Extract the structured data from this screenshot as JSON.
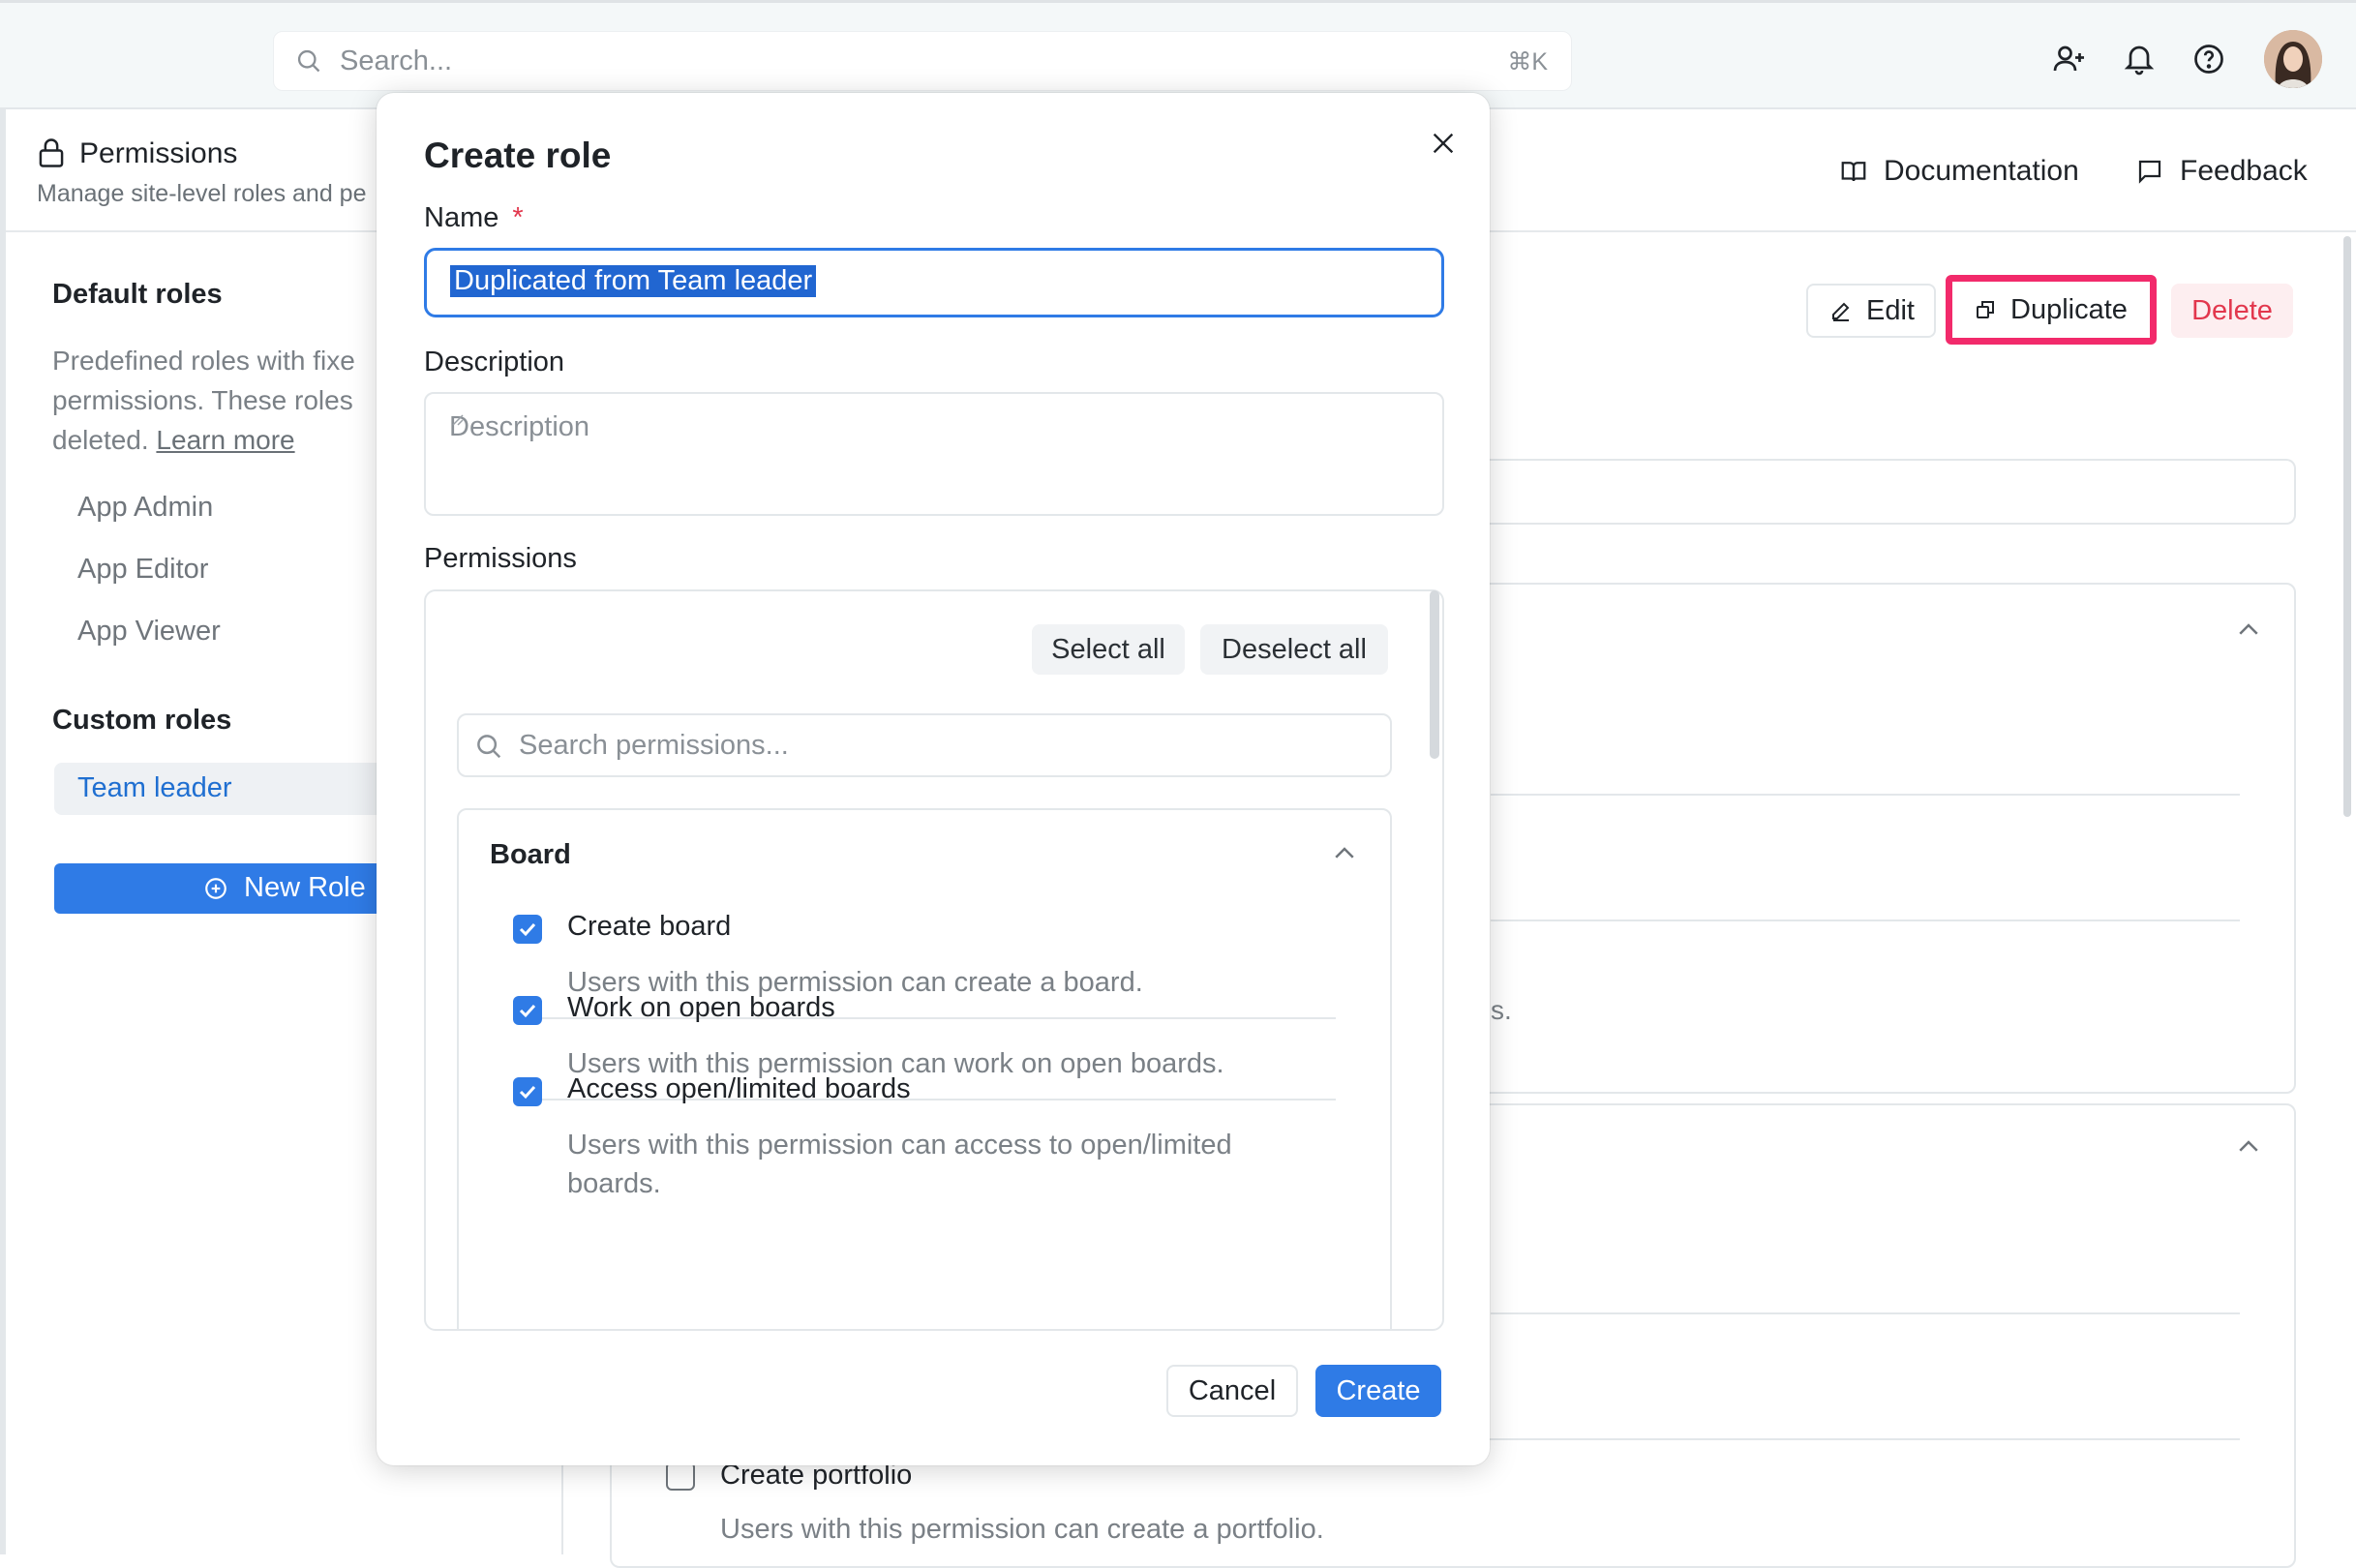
{
  "topbar": {
    "search_placeholder": "Search...",
    "search_shortcut": "⌘K",
    "icons": [
      "add-user-icon",
      "bell-icon",
      "help-icon"
    ]
  },
  "page": {
    "title": "Permissions",
    "subtitle": "Manage site-level roles and pe",
    "documentation": "Documentation",
    "feedback": "Feedback"
  },
  "sidebar": {
    "default_heading": "Default roles",
    "default_desc_lines": [
      "Predefined roles with fixe",
      "permissions. These roles",
      "deleted."
    ],
    "learn_more": "Learn more",
    "default_roles": [
      "App Admin",
      "App Editor",
      "App Viewer"
    ],
    "custom_heading": "Custom roles",
    "custom_roles": [
      "Team leader"
    ],
    "new_role": "New Role"
  },
  "role_actions": {
    "edit": "Edit",
    "duplicate": "Duplicate",
    "delete": "Delete"
  },
  "background": {
    "fragment_s": "s.",
    "portfolio_title": "Create portfolio",
    "portfolio_desc": "Users with this permission can create a portfolio."
  },
  "modal": {
    "title": "Create role",
    "name_label": "Name",
    "required_mark": "*",
    "name_value": "Duplicated from Team leader",
    "description_label": "Description",
    "description_placeholder": "Description",
    "permissions_label": "Permissions",
    "select_all": "Select all",
    "deselect_all": "Deselect all",
    "search_permissions_placeholder": "Search permissions...",
    "group": {
      "title": "Board",
      "items": [
        {
          "title": "Create board",
          "desc": "Users with this permission can create a board.",
          "checked": true
        },
        {
          "title": "Work on open boards",
          "desc": "Users with this permission can work on open boards.",
          "checked": true
        },
        {
          "title": "Access open/limited boards",
          "desc": "Users with this permission can access to open/limited boards.",
          "checked": true
        }
      ]
    },
    "cancel": "Cancel",
    "create": "Create"
  },
  "colors": {
    "accent": "#2f7be6",
    "danger": "#e2374d",
    "highlight_border": "#f22a6b"
  }
}
